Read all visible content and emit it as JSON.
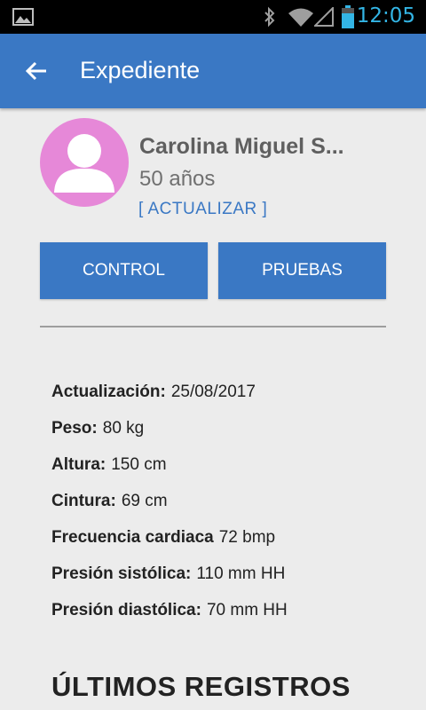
{
  "status_bar": {
    "time": "12:05"
  },
  "app_bar": {
    "title": "Expediente"
  },
  "profile": {
    "name": "Carolina Miguel S...",
    "age": "50 años",
    "update_label": "[ ACTUALIZAR ]"
  },
  "buttons": {
    "control": "CONTROL",
    "pruebas": "PRUEBAS"
  },
  "info": [
    {
      "label": "Actualización:",
      "value": "25/08/2017"
    },
    {
      "label": "Peso:",
      "value": "80 kg"
    },
    {
      "label": "Altura:",
      "value": "150 cm"
    },
    {
      "label": "Cintura:",
      "value": "69 cm"
    },
    {
      "label": "Frecuencia cardiaca",
      "value": "72 bmp"
    },
    {
      "label": "Presión sistólica:",
      "value": "110 mm HH"
    },
    {
      "label": "Presión diastólica:",
      "value": "70 mm HH"
    }
  ],
  "section": {
    "title": "ÚLTIMOS REGISTROS"
  },
  "colors": {
    "primary": "#3a78c4",
    "avatar_bg": "#e688d8",
    "status_time": "#33b5e5"
  },
  "icons": [
    "gallery-icon",
    "bluetooth-icon",
    "wifi-icon",
    "signal-icon",
    "battery-icon",
    "back-arrow-icon",
    "person-icon"
  ]
}
